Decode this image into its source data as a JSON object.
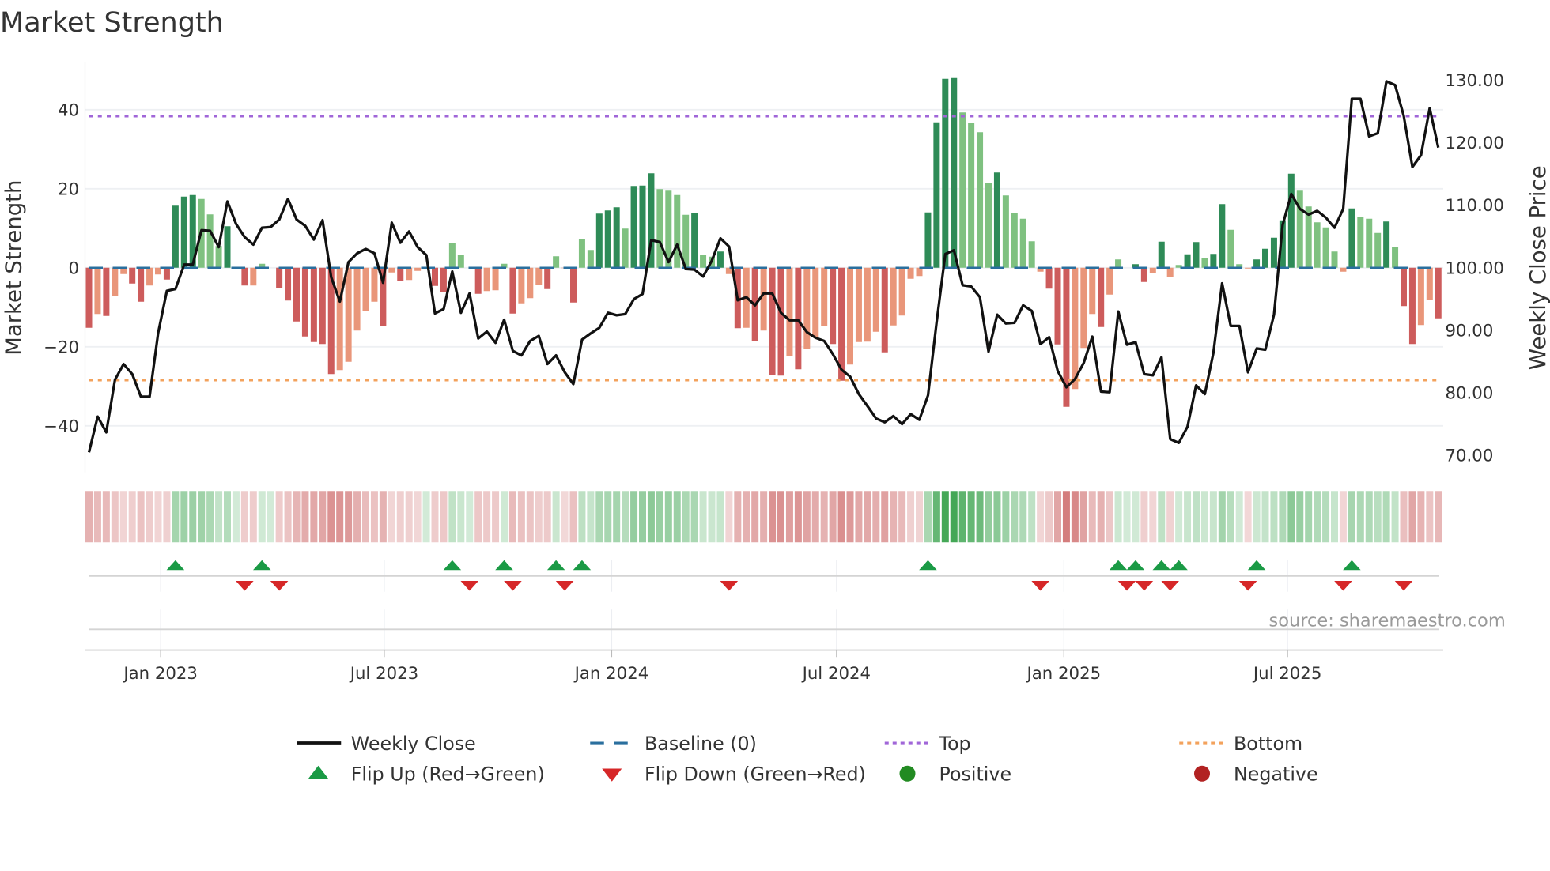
{
  "chart_data": {
    "type": "bar",
    "title": "Market Strength",
    "ylabel": "Market Strength",
    "y2label": "Weekly Close Price",
    "ylim": [
      -53,
      53
    ],
    "y2lim": [
      65,
      135
    ],
    "yticks": [
      "40",
      "20",
      "0",
      "−20",
      "−40"
    ],
    "ytick_values": [
      40,
      20,
      0,
      -20,
      -40
    ],
    "y2ticks": [
      "130.00",
      "120.00",
      "110.00",
      "100.00",
      "90.00",
      "80.00",
      "70.00"
    ],
    "y2tick_values": [
      130,
      120,
      110,
      100,
      90,
      80,
      70
    ],
    "start_date": "2022-11-04",
    "frequency": "weekly",
    "xticks": [
      {
        "label": "Jan 2023",
        "date": "2023-01-01"
      },
      {
        "label": "Jul 2023",
        "date": "2023-07-01"
      },
      {
        "label": "Jan 2024",
        "date": "2024-01-01"
      },
      {
        "label": "Jul 2024",
        "date": "2024-07-01"
      },
      {
        "label": "Jan 2025",
        "date": "2025-01-01"
      },
      {
        "label": "Jul 2025",
        "date": "2025-07-01"
      }
    ],
    "top_level": 38.3,
    "bottom_level": -28.5,
    "baseline": 0,
    "grid": true,
    "series": [
      {
        "name": "Market Strength",
        "type": "bar",
        "values": [
          -15.2,
          -11.7,
          -12.2,
          -7.2,
          -1.6,
          -4,
          -8.6,
          -4.5,
          -1.7,
          -3,
          15.7,
          18,
          18.4,
          17.4,
          13.5,
          5.5,
          10.5,
          0,
          -4.5,
          -4.5,
          1,
          0,
          -5.2,
          -8.3,
          -13.6,
          -17.4,
          -18.8,
          -19.3,
          -26.9,
          -25.9,
          -23.8,
          -15.9,
          -10.9,
          -8.6,
          -14.8,
          -1.2,
          -3.4,
          -3.1,
          -0.8,
          0,
          -4.6,
          -6.2,
          6.2,
          3.3,
          0,
          -6.6,
          -5.9,
          -5.7,
          1,
          -11.6,
          -9,
          -7.7,
          -4.3,
          -5.4,
          2.9,
          -0.1,
          -8.8,
          7.2,
          4.5,
          13.7,
          14.5,
          15.3,
          9.9,
          20.7,
          20.8,
          23.9,
          19.9,
          19.5,
          18.4,
          13.4,
          13.8,
          3.3,
          2.8,
          4.1,
          -1.6,
          -15.3,
          -15.2,
          -18.5,
          -15.9,
          -27.2,
          -27.3,
          -22.4,
          -25.7,
          -20.6,
          -17.5,
          -14.8,
          -19.3,
          -28.6,
          -24.5,
          -18.8,
          -18.7,
          -16.2,
          -21.4,
          -14.6,
          -12.1,
          -2.8,
          -2.1,
          14,
          36.8,
          47.8,
          48,
          39.3,
          36.7,
          34.3,
          21.4,
          24.1,
          18.3,
          13.8,
          12.4,
          6.7,
          -1,
          -5.3,
          -19.4,
          -35.2,
          -30.7,
          -20.3,
          -11.7,
          -15,
          -6.8,
          2.1,
          0,
          0.9,
          -3.6,
          -1.4,
          6.6,
          -2.3,
          0.7,
          3.4,
          6.5,
          2.4,
          3.5,
          16.1,
          9.6,
          0.9,
          -0.2,
          2.1,
          4.8,
          7.6,
          12,
          23.8,
          19.5,
          15.5,
          11.5,
          10.2,
          4.1,
          -1,
          15,
          12.8,
          12.4,
          8.8,
          11.7,
          5.3,
          -9.7,
          -19.3,
          -14.5,
          -8.1,
          -12.8
        ]
      },
      {
        "name": "Weekly Close",
        "type": "line",
        "axis": "right",
        "values": [
          70.5,
          76.2,
          73.7,
          82.1,
          84.6,
          83,
          79.4,
          79.4,
          89.6,
          96.3,
          96.6,
          100.5,
          100.5,
          106,
          105.9,
          103.3,
          110.6,
          107,
          104.9,
          103.7,
          106.4,
          106.5,
          107.7,
          111,
          107.7,
          106.7,
          104.5,
          107.6,
          98.5,
          94.6,
          100.9,
          102.3,
          103,
          102.3,
          97.6,
          107.2,
          104,
          105.8,
          103.3,
          102,
          92.7,
          93.4,
          99.4,
          92.8,
          95.9,
          88.7,
          89.8,
          88,
          91.7,
          86.7,
          86,
          88.3,
          89.1,
          84.6,
          86,
          83.3,
          81.4,
          88.5,
          89.5,
          90.4,
          92.8,
          92.4,
          92.6,
          95,
          95.8,
          104.4,
          104.1,
          100.9,
          103.7,
          99.8,
          99.7,
          98.6,
          101.1,
          104.7,
          103.4,
          94.8,
          95.3,
          94,
          95.9,
          95.9,
          92.8,
          91.6,
          91.6,
          89.7,
          88.8,
          88.3,
          86.2,
          83.7,
          82.6,
          79.8,
          77.9,
          75.9,
          75.3,
          76.3,
          75,
          76.6,
          75.7,
          79.6,
          91.3,
          102.2,
          102.8,
          97.2,
          97,
          95.3,
          86.6,
          92.5,
          91.1,
          91.2,
          94,
          93.1,
          87.8,
          88.9,
          83.5,
          80.9,
          82.2,
          84.8,
          89,
          80.2,
          80.1,
          93,
          87.7,
          88.1,
          83,
          82.8,
          85.7,
          72.6,
          72,
          74.6,
          81.2,
          79.8,
          86.4,
          97.5,
          90.7,
          90.7,
          83.3,
          87.1,
          86.9,
          92.5,
          106.8,
          111.8,
          109.4,
          108.5,
          109.1,
          108,
          106.4,
          109.4,
          127,
          127,
          121,
          121.5,
          129.8,
          129.2,
          124.3,
          116.1,
          118,
          125.5,
          119.2
        ]
      }
    ],
    "flip_up_weeks": [
      10,
      20,
      42,
      48,
      54,
      57,
      97,
      119,
      121,
      124,
      126,
      135,
      146
    ],
    "flip_down_weeks": [
      18,
      22,
      44,
      49,
      55,
      74,
      110,
      120,
      122,
      125,
      134,
      145,
      152
    ],
    "legend": {
      "placement": "bottom",
      "items": [
        {
          "label": "Weekly Close",
          "symbol": "line"
        },
        {
          "label": "Baseline (0)",
          "symbol": "dashed"
        },
        {
          "label": "Top",
          "symbol": "dotted-top"
        },
        {
          "label": "Bottom",
          "symbol": "dotted-bottom"
        },
        {
          "label": "Flip Up (Red→Green)",
          "symbol": "triangle-up"
        },
        {
          "label": "Flip Down (Green→Red)",
          "symbol": "triangle-down"
        },
        {
          "label": "Positive",
          "symbol": "circle-positive"
        },
        {
          "label": "Negative",
          "symbol": "circle-negative"
        }
      ]
    },
    "annotation": "source: sharemaestro.com",
    "colors": {
      "pos_dark": "#2e8b57",
      "pos_light": "#7fc180",
      "neg_dark": "#cd5c5c",
      "neg_light": "#e9967a",
      "line": "#111111",
      "baseline": "#2a6f9e",
      "top": "#a066d8",
      "bottom": "#f3a25c",
      "flip_up": "#1a9a45",
      "flip_down": "#d62728",
      "positive": "#228b22",
      "negative": "#b22222"
    }
  }
}
